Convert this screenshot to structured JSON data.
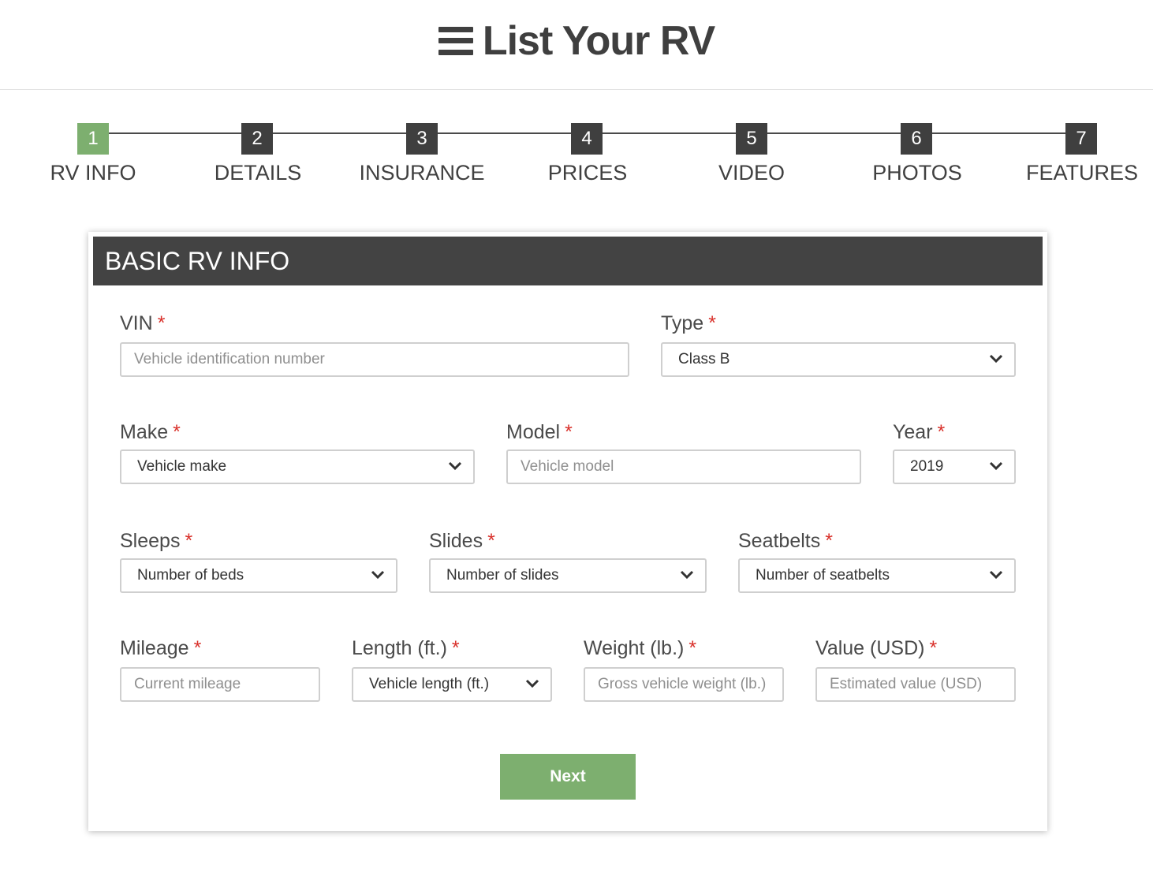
{
  "header": {
    "title": "List Your RV",
    "icon": "hamburger-menu-icon"
  },
  "steps": [
    {
      "number": "1",
      "label": "RV INFO",
      "active": true
    },
    {
      "number": "2",
      "label": "DETAILS",
      "active": false
    },
    {
      "number": "3",
      "label": "INSURANCE",
      "active": false
    },
    {
      "number": "4",
      "label": "PRICES",
      "active": false
    },
    {
      "number": "5",
      "label": "VIDEO",
      "active": false
    },
    {
      "number": "6",
      "label": "PHOTOS",
      "active": false
    },
    {
      "number": "7",
      "label": "FEATURES",
      "active": false
    }
  ],
  "form": {
    "section_title": "BASIC RV INFO",
    "required_mark": "*",
    "vin": {
      "label": "VIN",
      "placeholder": "Vehicle identification number",
      "value": ""
    },
    "type": {
      "label": "Type",
      "selected": "Class B"
    },
    "make": {
      "label": "Make",
      "selected": "Vehicle make"
    },
    "model": {
      "label": "Model",
      "placeholder": "Vehicle model",
      "value": ""
    },
    "year": {
      "label": "Year",
      "selected": "2019"
    },
    "sleeps": {
      "label": "Sleeps",
      "selected": "Number of beds"
    },
    "slides": {
      "label": "Slides",
      "selected": "Number of slides"
    },
    "seatbelts": {
      "label": "Seatbelts",
      "selected": "Number of seatbelts"
    },
    "mileage": {
      "label": "Mileage",
      "placeholder": "Current mileage",
      "value": ""
    },
    "length": {
      "label": "Length (ft.)",
      "selected": "Vehicle length (ft.)"
    },
    "weight": {
      "label": "Weight (lb.)",
      "placeholder": "Gross vehicle weight (lb.)",
      "value": ""
    },
    "value": {
      "label": "Value (USD)",
      "placeholder": "Estimated value (USD)",
      "value": ""
    },
    "next_label": "Next"
  },
  "colors": {
    "accent_green": "#7daf6f",
    "dark": "#434343",
    "required_red": "#d9312b"
  }
}
